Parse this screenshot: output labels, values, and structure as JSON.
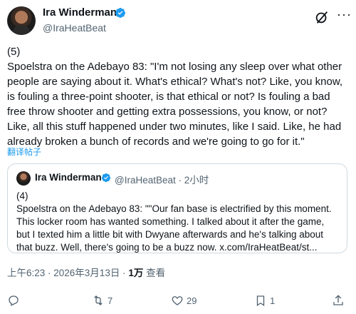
{
  "author": {
    "name": "Ira Winderman",
    "handle": "@IraHeatBeat"
  },
  "tweet": {
    "text": "(5)\nSpoelstra on the Adebayo 83: \"I'm not losing any sleep over what other people are saying about it. What's ethical? What's not? Like, you know, is fouling a three-point shooter, is that ethical or not? Is fouling a bad free throw shooter and getting extra possessions, you know, or not? Like, all this stuff happened under two minutes, like I said. Like, he had already broken a bunch of records and we're going to go for it.\"",
    "translate_label": "翻译帖子"
  },
  "quote": {
    "name": "Ira Winderman",
    "meta": "@IraHeatBeat · 2小时",
    "text": "(4)\nSpoelstra on the Adebayo 83: \"\"Our fan base is electrified by this moment. This locker room has wanted something. I talked about it after the game,  but I texted him a little bit with Dwyane afterwards and he's talking about that buzz. Well, there's going to be a buzz now. x.com/IraHeatBeat/st..."
  },
  "meta": {
    "time": "上午6:23 · 2026年3月13日 · ",
    "views": "1万",
    "views_label": " 查看"
  },
  "actions": {
    "retweets": "7",
    "likes": "29",
    "bookmarks": "1"
  },
  "colors": {
    "accent": "#1d9bf0",
    "text": "#0f1419",
    "muted": "#536471"
  },
  "icons": [
    "verified-icon",
    "grok-icon",
    "more-icon",
    "reply-icon",
    "retweet-icon",
    "like-icon",
    "bookmark-icon",
    "share-icon"
  ]
}
